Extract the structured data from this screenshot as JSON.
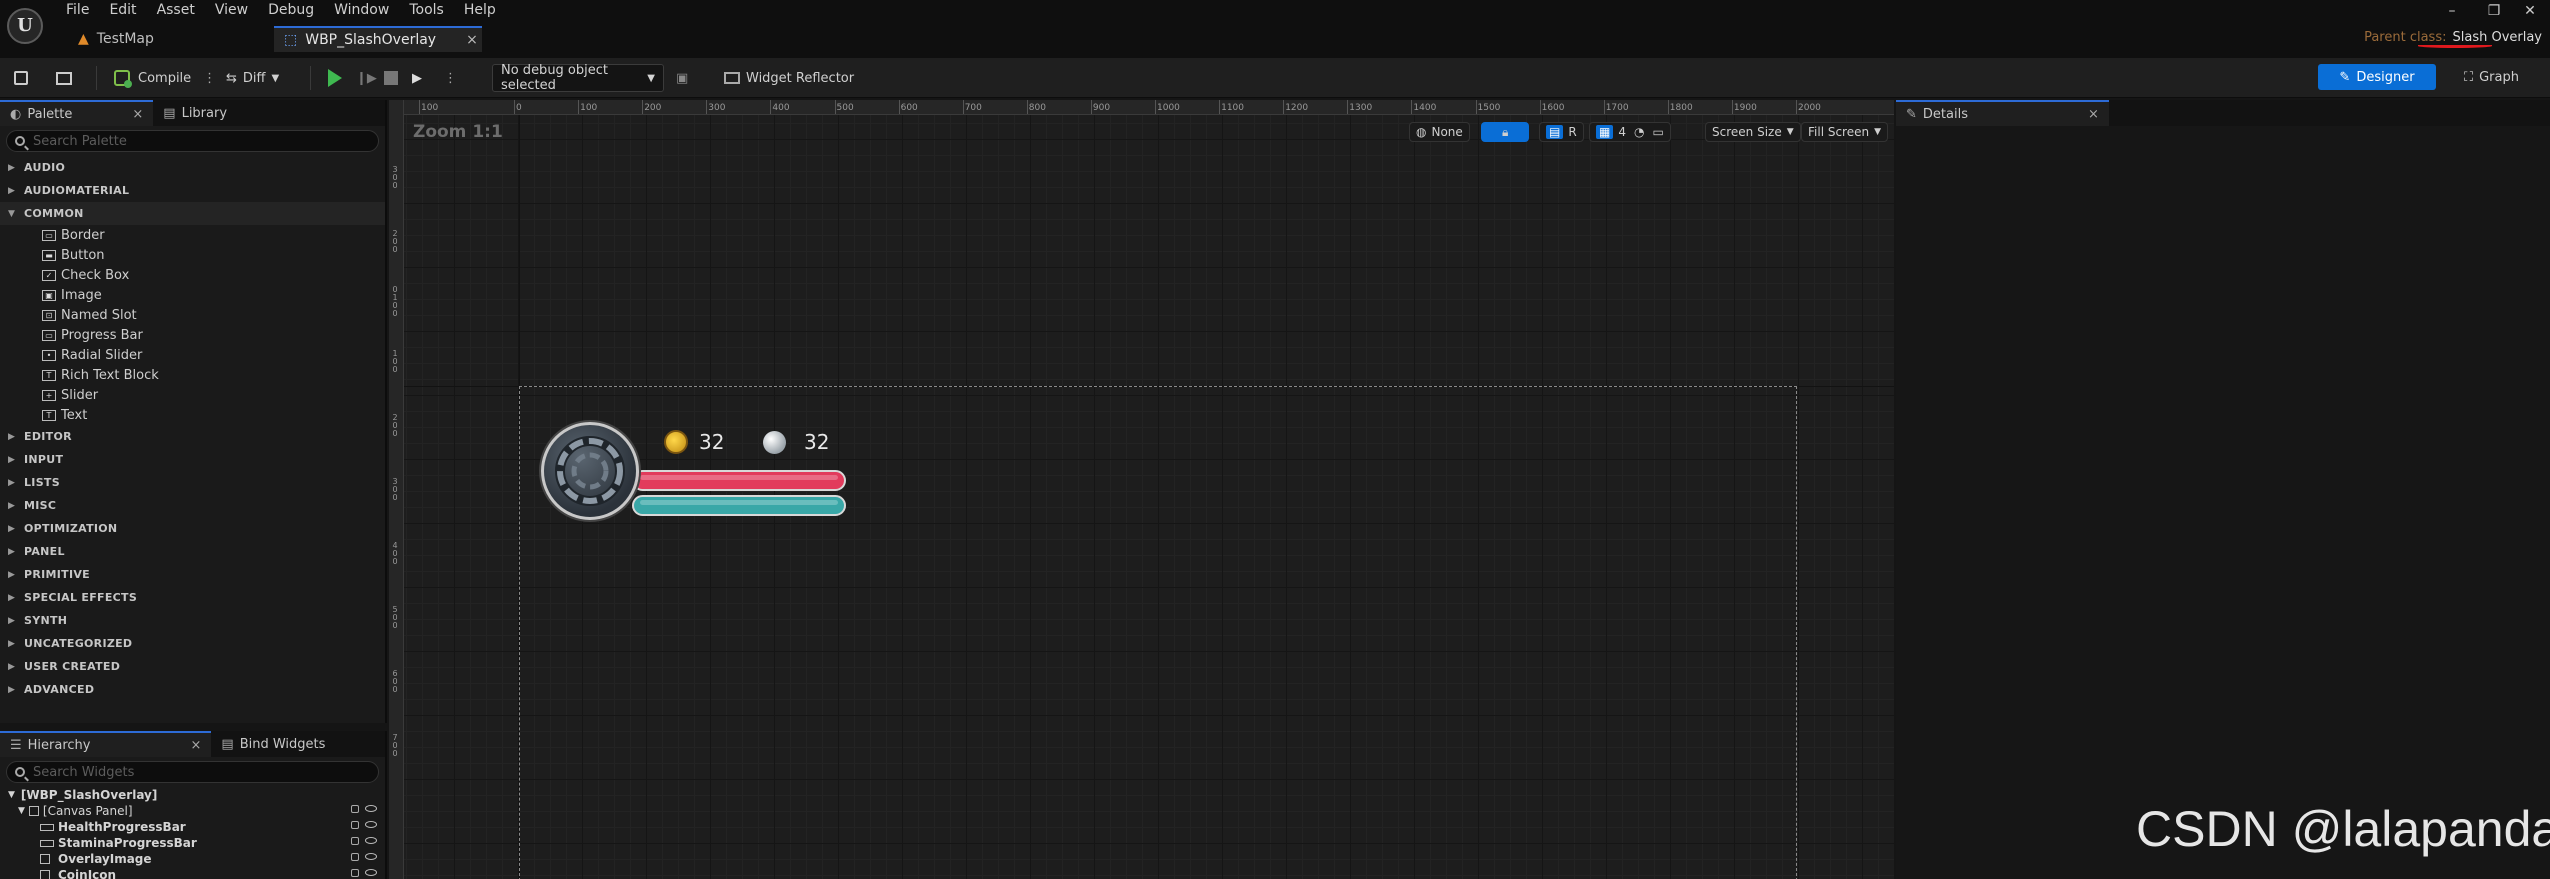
{
  "menu": [
    "File",
    "Edit",
    "Asset",
    "View",
    "Debug",
    "Window",
    "Tools",
    "Help"
  ],
  "tabs": [
    {
      "label": "TestMap"
    },
    {
      "label": "WBP_SlashOverlay",
      "close": "×"
    }
  ],
  "window_controls": {
    "minimize": "–",
    "restore": "❐",
    "close": "✕"
  },
  "parent_class": {
    "label": "Parent class:",
    "value": "Slash Overlay"
  },
  "toolbar": {
    "compile": "Compile",
    "diff": "Diff",
    "debug_object": "No debug object selected",
    "widget_reflector": "Widget Reflector",
    "designer": "Designer",
    "graph": "Graph"
  },
  "palette": {
    "tab": "Palette",
    "library_tab": "Library",
    "close": "×",
    "search_placeholder": "Search Palette",
    "categories_before": [
      "AUDIO",
      "AUDIOMATERIAL"
    ],
    "open_category": "COMMON",
    "common_items": [
      {
        "label": "Border",
        "icon": "▭"
      },
      {
        "label": "Button",
        "icon": "▬"
      },
      {
        "label": "Check Box",
        "icon": "✓"
      },
      {
        "label": "Image",
        "icon": "▣"
      },
      {
        "label": "Named Slot",
        "icon": "⊡"
      },
      {
        "label": "Progress Bar",
        "icon": "▭"
      },
      {
        "label": "Radial Slider",
        "icon": "•"
      },
      {
        "label": "Rich Text Block",
        "icon": "T"
      },
      {
        "label": "Slider",
        "icon": "+"
      },
      {
        "label": "Text",
        "icon": "T"
      }
    ],
    "categories_after": [
      "EDITOR",
      "INPUT",
      "LISTS",
      "MISC",
      "OPTIMIZATION",
      "PANEL",
      "PRIMITIVE",
      "SPECIAL EFFECTS",
      "SYNTH",
      "UNCATEGORIZED",
      "USER CREATED",
      "ADVANCED"
    ]
  },
  "hierarchy": {
    "tab": "Hierarchy",
    "close": "×",
    "bind_tab": "Bind Widgets",
    "search_placeholder": "Search Widgets",
    "rows": [
      {
        "label": "[WBP_SlashOverlay]"
      },
      {
        "label": "[Canvas Panel]"
      },
      {
        "label": "HealthProgressBar"
      },
      {
        "label": "StaminaProgressBar"
      },
      {
        "label": "OverlayImage"
      },
      {
        "label": "CoinIcon"
      }
    ]
  },
  "canvas": {
    "zoom": "Zoom 1:1",
    "ruler_top": [
      "100",
      "0",
      "100",
      "200",
      "300",
      "400",
      "500",
      "600",
      "700",
      "800",
      "900",
      "1000",
      "1100",
      "1200",
      "1300",
      "1400",
      "1500",
      "1600",
      "1700",
      "1800",
      "1900",
      "2000"
    ],
    "ruler_left": [
      "300",
      "200",
      "100",
      "0",
      "100",
      "200",
      "300",
      "400",
      "500",
      "600",
      "700"
    ],
    "view_tools": {
      "none": "None",
      "r": "R",
      "grid": "4",
      "screen_size": "Screen Size",
      "fill_screen": "Fill Screen"
    },
    "hud": {
      "coins": "32",
      "souls": "32",
      "health_percent": 100,
      "stamina_percent": 100
    }
  },
  "details": {
    "tab": "Details",
    "close": "×"
  },
  "watermark": "CSDN @lalapanda"
}
